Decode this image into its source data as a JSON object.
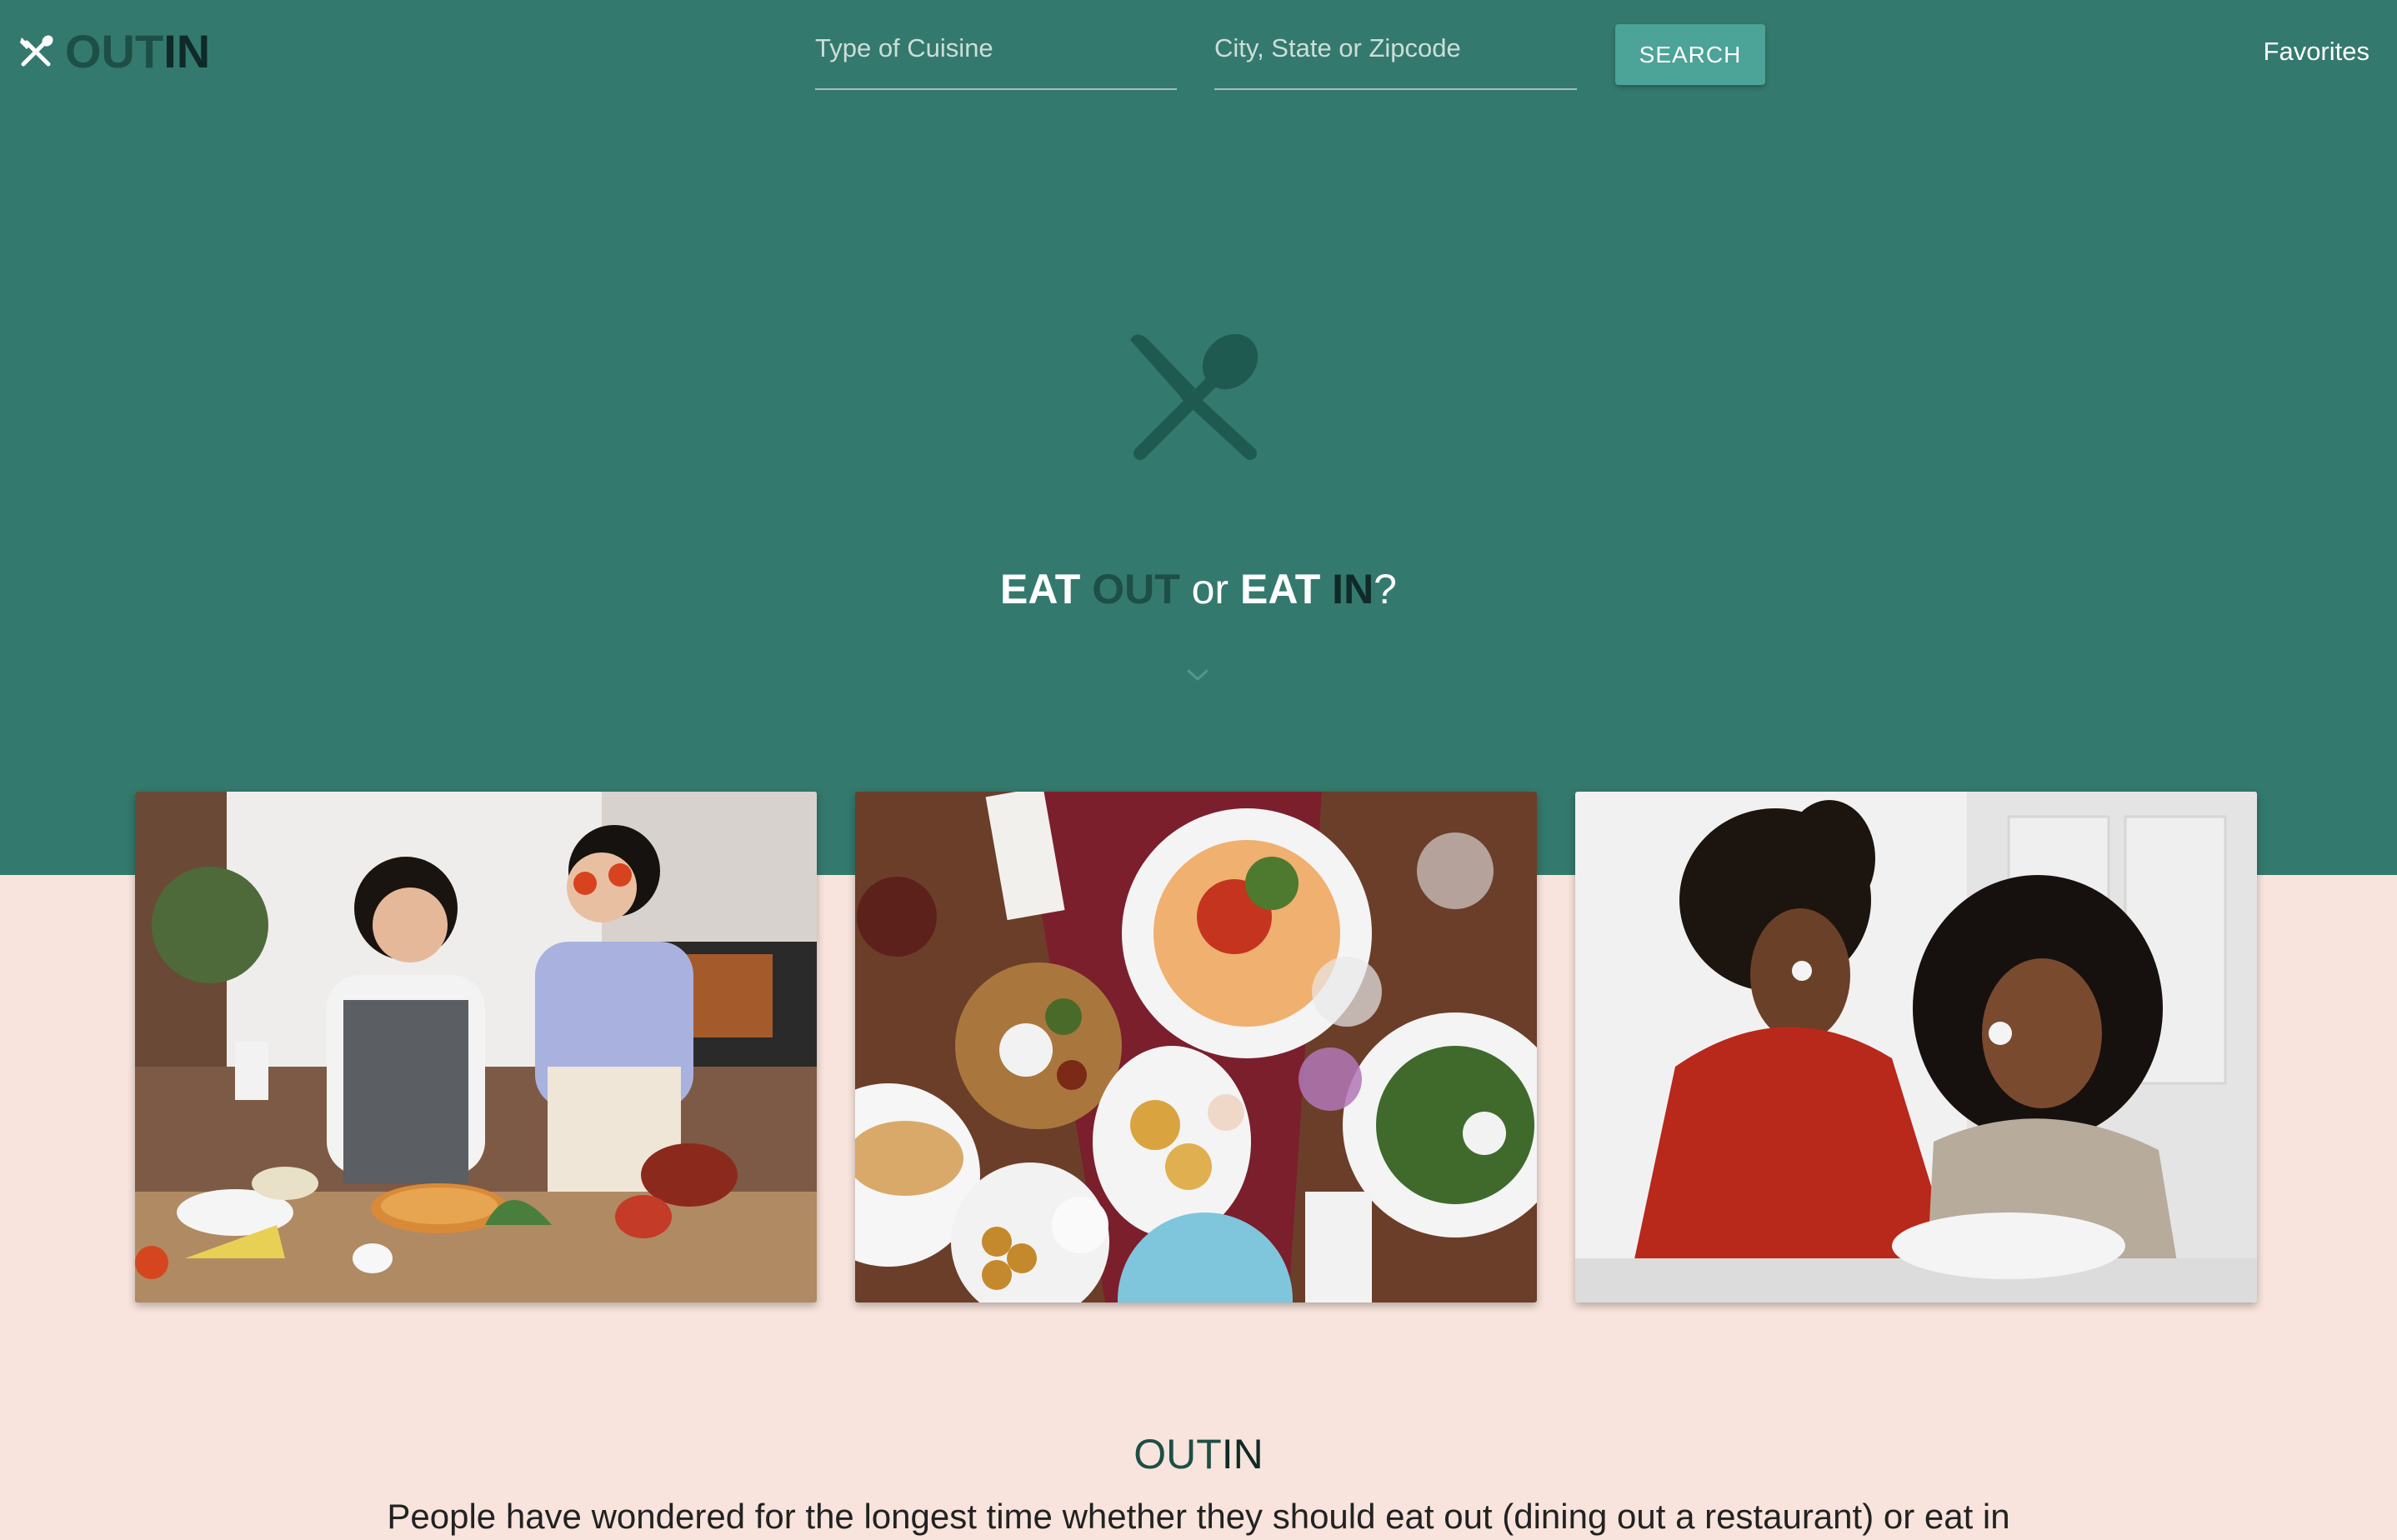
{
  "colors": {
    "hero_bg": "#34796d",
    "page_bg": "#f8e4dc",
    "accent_button": "#4ca397",
    "brand_dark": "#1d4f47",
    "brand_darker": "#0f2a27"
  },
  "header": {
    "logo_icon": "utensils-crossed-icon",
    "brand_out": "OUT",
    "brand_in": "IN",
    "cuisine_placeholder": "Type of Cuisine",
    "location_placeholder": "City, State or Zipcode",
    "search_label": "SEARCH",
    "favorites_label": "Favorites"
  },
  "hero": {
    "icon": "fork-spoon-crossed-icon",
    "tagline": {
      "eat1": "EAT ",
      "out": "OUT",
      "or": " or ",
      "eat2": "EAT ",
      "in": "IN",
      "q": "?"
    },
    "scroll_icon": "chevron-down-icon"
  },
  "photos": [
    {
      "name": "two women cooking pizza in kitchen"
    },
    {
      "name": "restaurant table spread from above"
    },
    {
      "name": "mother and daughter baking at home"
    }
  ],
  "about": {
    "title_out": "OUT",
    "title_in": "IN",
    "text": "People have wondered for the longest time whether they should eat out (dining out a restaurant) or eat in"
  }
}
